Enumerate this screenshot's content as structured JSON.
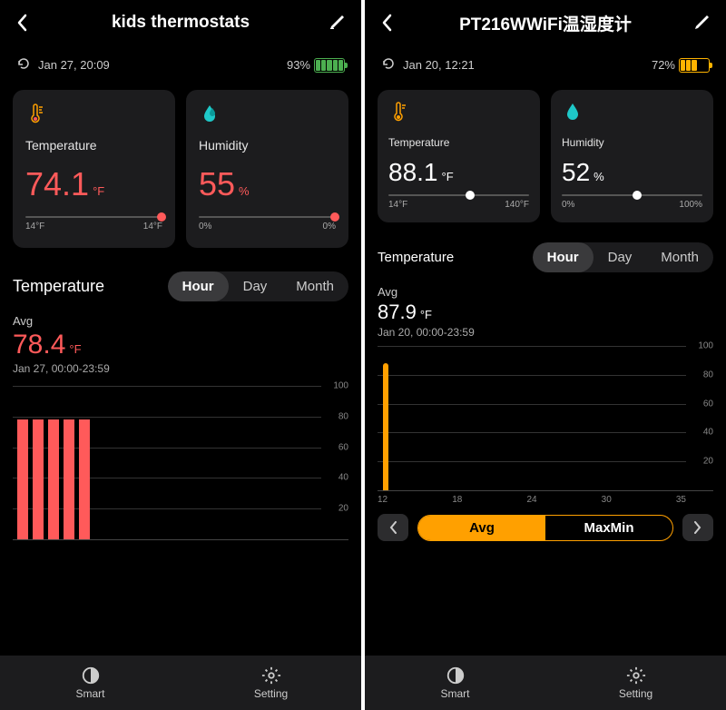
{
  "left": {
    "title": "kids thermostats",
    "timestamp": "Jan 27, 20:09",
    "battery_pct": "93%",
    "temp": {
      "label": "Temperature",
      "value": "74.1",
      "unit": "°F",
      "range_min": "14°F",
      "range_max": "14°F"
    },
    "humidity": {
      "label": "Humidity",
      "value": "55",
      "unit": "%",
      "range_min": "0%",
      "range_max": "0%"
    },
    "time_label": "Temperature",
    "tabs": {
      "hour": "Hour",
      "day": "Day",
      "month": "Month"
    },
    "avg": {
      "label": "Avg",
      "value": "78.4",
      "unit": "°F",
      "time": "Jan 27, 00:00-23:59"
    },
    "nav": {
      "smart": "Smart",
      "setting": "Setting"
    }
  },
  "right": {
    "title": "PT216WWiFi温湿度计",
    "timestamp": "Jan 20, 12:21",
    "battery_pct": "72%",
    "temp": {
      "label": "Temperature",
      "value": "88.1",
      "unit": "°F",
      "range_min": "14°F",
      "range_max": "140°F"
    },
    "humidity": {
      "label": "Humidity",
      "value": "52",
      "unit": "%",
      "range_min": "0%",
      "range_max": "100%"
    },
    "time_label": "Temperature",
    "tabs": {
      "hour": "Hour",
      "day": "Day",
      "month": "Month"
    },
    "avg": {
      "label": "Avg",
      "value": "87.9",
      "unit": "°F",
      "time": "Jan 20, 00:00-23:59"
    },
    "avgmax": {
      "avg": "Avg",
      "maxmin": "MaxMin"
    },
    "xticks": {
      "a": "12",
      "b": "18",
      "c": "24",
      "d": "30",
      "e": "35"
    },
    "nav": {
      "smart": "Smart",
      "setting": "Setting"
    }
  },
  "chart_data": [
    {
      "type": "bar",
      "title": "Temperature Avg (Hour) — kids thermostats",
      "x": [
        0,
        1,
        2,
        3,
        4
      ],
      "values": [
        78,
        78,
        78,
        78,
        78
      ],
      "ylim": [
        0,
        100
      ],
      "ylabel": "°F"
    },
    {
      "type": "bar",
      "title": "Temperature Avg (Hour) — PT216WWiFi",
      "categories": [
        12
      ],
      "values": [
        88
      ],
      "ylim": [
        0,
        100
      ],
      "ylabel": "°F",
      "x_ticks": [
        12,
        18,
        24,
        30,
        35
      ]
    }
  ],
  "yticks": {
    "t100": "100",
    "t80": "80",
    "t60": "60",
    "t40": "40",
    "t20": "20"
  }
}
